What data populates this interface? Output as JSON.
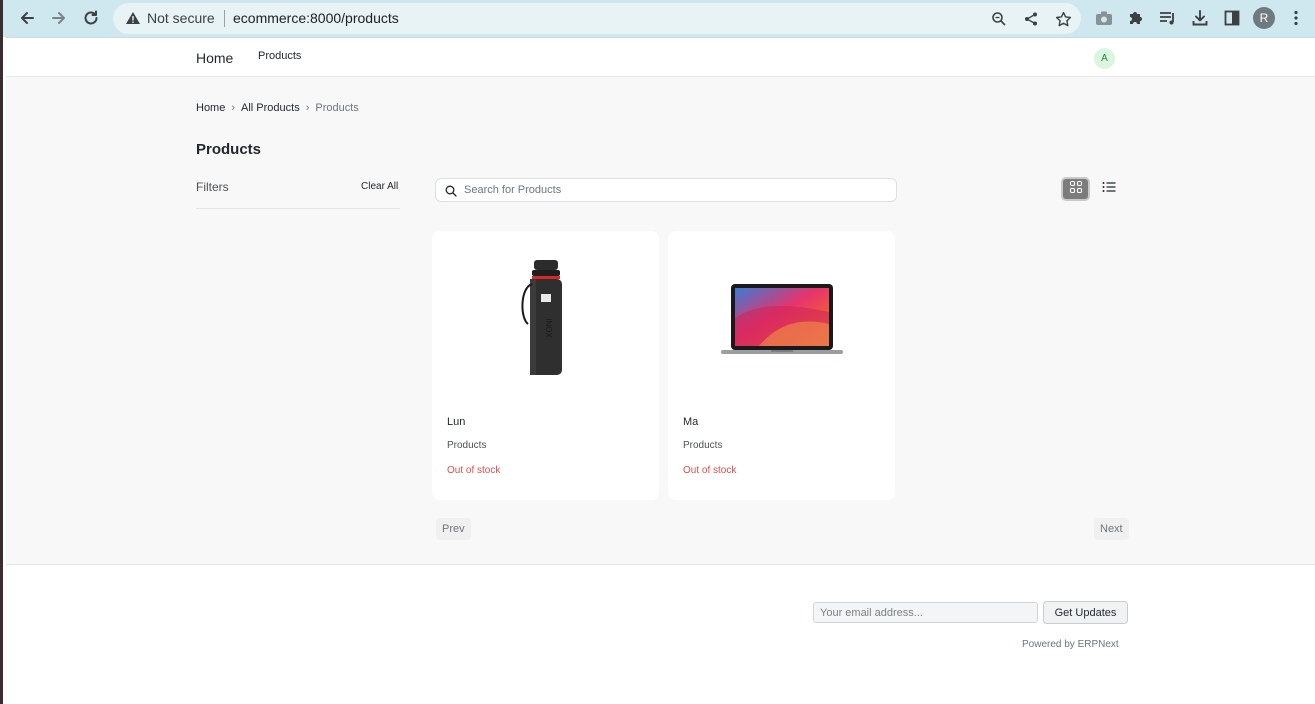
{
  "browser": {
    "security_label": "Not secure",
    "url": "ecommerce:8000/products",
    "profile_initial": "R"
  },
  "navbar": {
    "home_label": "Home",
    "products_label": "Products",
    "avatar_initial": "A"
  },
  "breadcrumb": {
    "items": [
      "Home",
      "All Products"
    ],
    "current": "Products"
  },
  "page": {
    "title": "Products"
  },
  "filters": {
    "label": "Filters",
    "clear_all": "Clear All"
  },
  "search": {
    "placeholder": "Search for Products",
    "value": ""
  },
  "products": [
    {
      "name": "Lun",
      "category": "Products",
      "stock": "Out of stock",
      "image": "water-bottle"
    },
    {
      "name": "Ma",
      "category": "Products",
      "stock": "Out of stock",
      "image": "laptop"
    }
  ],
  "pagination": {
    "prev": "Prev",
    "next": "Next"
  },
  "footer": {
    "email_placeholder": "Your email address...",
    "updates_button": "Get Updates",
    "powered_by": "Powered by ERPNext"
  },
  "colors": {
    "chrome_bg": "#cfe7ee",
    "page_bg": "#f8f8f8",
    "out_of_stock": "#e24c4c",
    "avatar_bg": "#daf5e0"
  }
}
